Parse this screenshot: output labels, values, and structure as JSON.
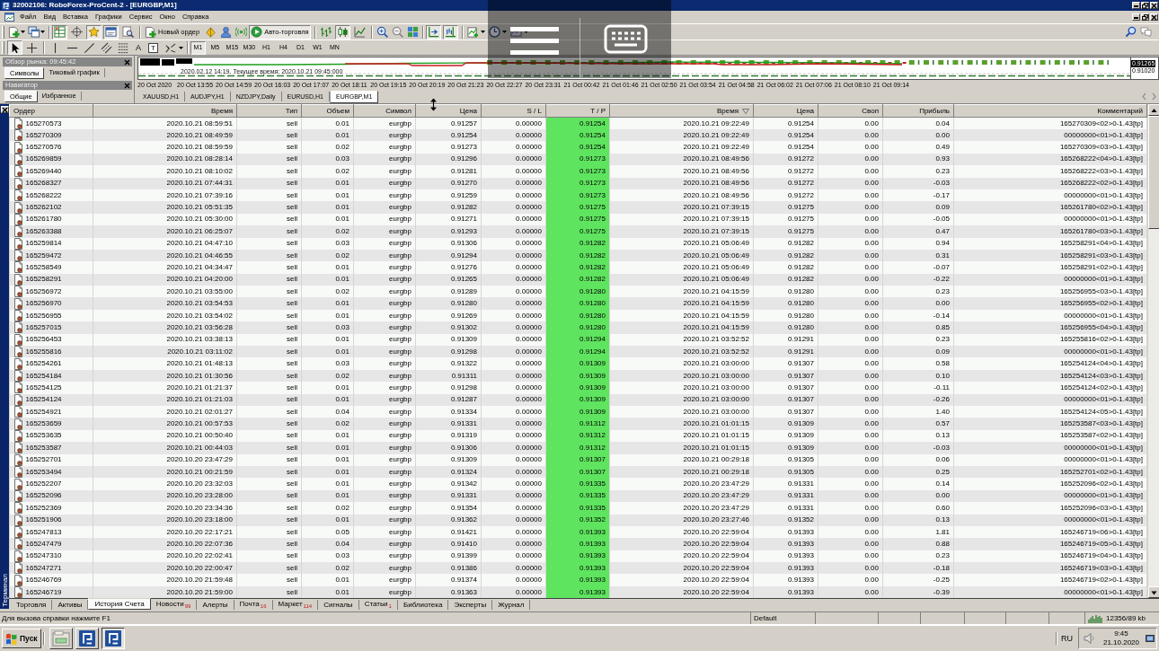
{
  "window": {
    "title": "32002106: RoboForex-ProCent-2 - [EURGBP,M1]"
  },
  "menu": [
    "Файл",
    "Вид",
    "Вставка",
    "Графики",
    "Сервис",
    "Окно",
    "Справка"
  ],
  "toolbar": {
    "panels": [
      {
        "kind": "market_watch",
        "on": true
      },
      {
        "kind": "data_window",
        "on": false
      },
      {
        "kind": "navigator",
        "on": true
      },
      {
        "kind": "terminal",
        "on": true
      },
      {
        "kind": "tester",
        "on": false
      }
    ],
    "new_order": "Новый ордер",
    "auto_trading": {
      "label": "Авто-торговля",
      "on": true
    },
    "chart_types": [
      {
        "kind": "bars",
        "selected": false
      },
      {
        "kind": "candles",
        "selected": true
      },
      {
        "kind": "line",
        "selected": false
      }
    ],
    "view_toggles": [
      {
        "kind": "auto_scroll",
        "on": true
      },
      {
        "kind": "chart_shift",
        "on": true
      }
    ]
  },
  "drawing_toolbar": {
    "modes": [
      {
        "kind": "cursor",
        "selected": true
      },
      {
        "kind": "crosshair",
        "selected": false
      }
    ],
    "text_tool": "A",
    "label_tool": "T",
    "periods": [
      {
        "label": "M1",
        "selected": true
      },
      {
        "label": "M5",
        "selected": false
      },
      {
        "label": "M15",
        "selected": false
      },
      {
        "label": "M30",
        "selected": false
      },
      {
        "label": "H1",
        "selected": false
      },
      {
        "label": "H4",
        "selected": false
      },
      {
        "label": "D1",
        "selected": false
      },
      {
        "label": "W1",
        "selected": false
      },
      {
        "label": "MN",
        "selected": false
      }
    ]
  },
  "market_watch": {
    "title": "Обзор рынка: 09:45:42",
    "tabs": [
      {
        "label": "Символы",
        "selected": true
      },
      {
        "label": "Тиковый график",
        "selected": false
      }
    ]
  },
  "navigator": {
    "title": "Навигатор",
    "tabs": [
      {
        "label": "Общие",
        "selected": true
      },
      {
        "label": "Избранное",
        "selected": false
      }
    ]
  },
  "chart": {
    "caption": "2020.02.12 14:19. Текущее время: 2020.10.21 09:45:000",
    "price_labels": [
      {
        "text": "0.91265",
        "kind": "current"
      },
      {
        "text": "0.91020",
        "kind": "level"
      }
    ],
    "time_labels": [
      "20 Oct 2020",
      "20 Oct 13:55",
      "20 Oct 14:59",
      "20 Oct 16:03",
      "20 Oct 17:07",
      "20 Oct 18:11",
      "20 Oct 19:15",
      "20 Oct 20:19",
      "20 Oct 21:23",
      "20 Oct 22:27",
      "20 Oct 23:31",
      "21 Oct 00:42",
      "21 Oct 01:46",
      "21 Oct 02:50",
      "21 Oct 03:54",
      "21 Oct 04:58",
      "21 Oct 06:02",
      "21 Oct 07:06",
      "21 Oct 08:10",
      "21 Oct 09:14"
    ],
    "tabs": [
      {
        "label": "XAUUSD,H1",
        "selected": false
      },
      {
        "label": "AUDJPY,H1",
        "selected": false
      },
      {
        "label": "NZDJPY,Daily",
        "selected": false
      },
      {
        "label": "EURUSD,H1",
        "selected": false
      },
      {
        "label": "EURGBP,M1",
        "selected": true
      }
    ]
  },
  "terminal": {
    "title": "Терминал",
    "columns": [
      {
        "label": "Ордер",
        "sorted": false,
        "highlighted": false
      },
      {
        "label": "Время",
        "sorted": false,
        "highlighted": false
      },
      {
        "label": "Тип",
        "sorted": false,
        "highlighted": false
      },
      {
        "label": "Объем",
        "sorted": false,
        "highlighted": false
      },
      {
        "label": "Символ",
        "sorted": false,
        "highlighted": false
      },
      {
        "label": "Цена",
        "sorted": false,
        "highlighted": false
      },
      {
        "label": "S / L",
        "sorted": false,
        "highlighted": false
      },
      {
        "label": "T / P",
        "sorted": false,
        "highlighted": true
      },
      {
        "label": "Время",
        "sorted": true,
        "highlighted": false
      },
      {
        "label": "Цена",
        "sorted": false,
        "highlighted": false
      },
      {
        "label": "Своп",
        "sorted": false,
        "highlighted": false
      },
      {
        "label": "Прибыль",
        "sorted": false,
        "highlighted": false
      },
      {
        "label": "Комментарий",
        "sorted": false,
        "highlighted": false
      }
    ],
    "rows": [
      [
        "165270573",
        "2020.10.21 08:59:51",
        "sell",
        "0.01",
        "eurgbp",
        "0.91257",
        "0.00000",
        "0.91254",
        "2020.10.21 09:22:49",
        "0.91254",
        "0.00",
        "0.04",
        "165270309<02>0-1.43[tp]"
      ],
      [
        "165270309",
        "2020.10.21 08:49:59",
        "sell",
        "0.01",
        "eurgbp",
        "0.91254",
        "0.00000",
        "0.91254",
        "2020.10.21 09:22:49",
        "0.91254",
        "0.00",
        "0.00",
        "00000000<01>0-1.43[tp]"
      ],
      [
        "165270576",
        "2020.10.21 08:59:59",
        "sell",
        "0.02",
        "eurgbp",
        "0.91273",
        "0.00000",
        "0.91254",
        "2020.10.21 09:22:49",
        "0.91254",
        "0.00",
        "0.49",
        "165270309<03>0-1.43[tp]"
      ],
      [
        "165269859",
        "2020.10.21 08:28:14",
        "sell",
        "0.03",
        "eurgbp",
        "0.91296",
        "0.00000",
        "0.91273",
        "2020.10.21 08:49:56",
        "0.91272",
        "0.00",
        "0.93",
        "165268222<04>0-1.43[tp]"
      ],
      [
        "165269440",
        "2020.10.21 08:10:02",
        "sell",
        "0.02",
        "eurgbp",
        "0.91281",
        "0.00000",
        "0.91273",
        "2020.10.21 08:49:56",
        "0.91272",
        "0.00",
        "0.23",
        "165268222<03>0-1.43[tp]"
      ],
      [
        "165268327",
        "2020.10.21 07:44:31",
        "sell",
        "0.01",
        "eurgbp",
        "0.91270",
        "0.00000",
        "0.91273",
        "2020.10.21 08:49:56",
        "0.91272",
        "0.00",
        "-0.03",
        "165268222<02>0-1.43[tp]"
      ],
      [
        "165268222",
        "2020.10.21 07:39:16",
        "sell",
        "0.01",
        "eurgbp",
        "0.91259",
        "0.00000",
        "0.91273",
        "2020.10.21 08:49:56",
        "0.91272",
        "0.00",
        "-0.17",
        "00000000<01>0-1.43[tp]"
      ],
      [
        "165262102",
        "2020.10.21 05:51:35",
        "sell",
        "0.01",
        "eurgbp",
        "0.91282",
        "0.00000",
        "0.91275",
        "2020.10.21 07:39:15",
        "0.91275",
        "0.00",
        "0.09",
        "165261780<02>0-1.43[tp]"
      ],
      [
        "165261780",
        "2020.10.21 05:30:00",
        "sell",
        "0.01",
        "eurgbp",
        "0.91271",
        "0.00000",
        "0.91275",
        "2020.10.21 07:39:15",
        "0.91275",
        "0.00",
        "-0.05",
        "00000000<01>0-1.43[tp]"
      ],
      [
        "165263388",
        "2020.10.21 06:25:07",
        "sell",
        "0.02",
        "eurgbp",
        "0.91293",
        "0.00000",
        "0.91275",
        "2020.10.21 07:39:15",
        "0.91275",
        "0.00",
        "0.47",
        "165261780<03>0-1.43[tp]"
      ],
      [
        "165259814",
        "2020.10.21 04:47:10",
        "sell",
        "0.03",
        "eurgbp",
        "0.91306",
        "0.00000",
        "0.91282",
        "2020.10.21 05:06:49",
        "0.91282",
        "0.00",
        "0.94",
        "165258291<04>0-1.43[tp]"
      ],
      [
        "165259472",
        "2020.10.21 04:46:55",
        "sell",
        "0.02",
        "eurgbp",
        "0.91294",
        "0.00000",
        "0.91282",
        "2020.10.21 05:06:49",
        "0.91282",
        "0.00",
        "0.31",
        "165258291<03>0-1.43[tp]"
      ],
      [
        "165258549",
        "2020.10.21 04:34:47",
        "sell",
        "0.01",
        "eurgbp",
        "0.91276",
        "0.00000",
        "0.91282",
        "2020.10.21 05:06:49",
        "0.91282",
        "0.00",
        "-0.07",
        "165258291<02>0-1.43[tp]"
      ],
      [
        "165258291",
        "2020.10.21 04:20:00",
        "sell",
        "0.01",
        "eurgbp",
        "0.91265",
        "0.00000",
        "0.91282",
        "2020.10.21 05:06:49",
        "0.91282",
        "0.00",
        "-0.22",
        "00000000<01>0-1.43[tp]"
      ],
      [
        "165256972",
        "2020.10.21 03:55:00",
        "sell",
        "0.02",
        "eurgbp",
        "0.91289",
        "0.00000",
        "0.91280",
        "2020.10.21 04:15:59",
        "0.91280",
        "0.00",
        "0.23",
        "165256955<03>0-1.43[tp]"
      ],
      [
        "165256970",
        "2020.10.21 03:54:53",
        "sell",
        "0.01",
        "eurgbp",
        "0.91280",
        "0.00000",
        "0.91280",
        "2020.10.21 04:15:59",
        "0.91280",
        "0.00",
        "0.00",
        "165256955<02>0-1.43[tp]"
      ],
      [
        "165256955",
        "2020.10.21 03:54:02",
        "sell",
        "0.01",
        "eurgbp",
        "0.91269",
        "0.00000",
        "0.91280",
        "2020.10.21 04:15:59",
        "0.91280",
        "0.00",
        "-0.14",
        "00000000<01>0-1.43[tp]"
      ],
      [
        "165257015",
        "2020.10.21 03:56:28",
        "sell",
        "0.03",
        "eurgbp",
        "0.91302",
        "0.00000",
        "0.91280",
        "2020.10.21 04:15:59",
        "0.91280",
        "0.00",
        "0.85",
        "165256955<04>0-1.43[tp]"
      ],
      [
        "165256453",
        "2020.10.21 03:38:13",
        "sell",
        "0.01",
        "eurgbp",
        "0.91309",
        "0.00000",
        "0.91294",
        "2020.10.21 03:52:52",
        "0.91291",
        "0.00",
        "0.23",
        "165255816<02>0-1.43[tp]"
      ],
      [
        "165255816",
        "2020.10.21 03:11:02",
        "sell",
        "0.01",
        "eurgbp",
        "0.91298",
        "0.00000",
        "0.91294",
        "2020.10.21 03:52:52",
        "0.91291",
        "0.00",
        "0.09",
        "00000000<01>0-1.43[tp]"
      ],
      [
        "165254261",
        "2020.10.21 01:48:13",
        "sell",
        "0.03",
        "eurgbp",
        "0.91322",
        "0.00000",
        "0.91309",
        "2020.10.21 03:00:00",
        "0.91307",
        "0.00",
        "0.58",
        "165254124<04>0-1.43[tp]"
      ],
      [
        "165254184",
        "2020.10.21 01:30:56",
        "sell",
        "0.02",
        "eurgbp",
        "0.91311",
        "0.00000",
        "0.91309",
        "2020.10.21 03:00:00",
        "0.91307",
        "0.00",
        "0.10",
        "165254124<03>0-1.43[tp]"
      ],
      [
        "165254125",
        "2020.10.21 01:21:37",
        "sell",
        "0.01",
        "eurgbp",
        "0.91298",
        "0.00000",
        "0.91309",
        "2020.10.21 03:00:00",
        "0.91307",
        "0.00",
        "-0.11",
        "165254124<02>0-1.43[tp]"
      ],
      [
        "165254124",
        "2020.10.21 01:21:03",
        "sell",
        "0.01",
        "eurgbp",
        "0.91287",
        "0.00000",
        "0.91309",
        "2020.10.21 03:00:00",
        "0.91307",
        "0.00",
        "-0.26",
        "00000000<01>0-1.43[tp]"
      ],
      [
        "165254921",
        "2020.10.21 02:01:27",
        "sell",
        "0.04",
        "eurgbp",
        "0.91334",
        "0.00000",
        "0.91309",
        "2020.10.21 03:00:00",
        "0.91307",
        "0.00",
        "1.40",
        "165254124<05>0-1.43[tp]"
      ],
      [
        "165253659",
        "2020.10.21 00:57:53",
        "sell",
        "0.02",
        "eurgbp",
        "0.91331",
        "0.00000",
        "0.91312",
        "2020.10.21 01:01:15",
        "0.91309",
        "0.00",
        "0.57",
        "165253587<03>0-1.43[tp]"
      ],
      [
        "165253635",
        "2020.10.21 00:50:40",
        "sell",
        "0.01",
        "eurgbp",
        "0.91319",
        "0.00000",
        "0.91312",
        "2020.10.21 01:01:15",
        "0.91309",
        "0.00",
        "0.13",
        "165253587<02>0-1.43[tp]"
      ],
      [
        "165253587",
        "2020.10.21 00:44:03",
        "sell",
        "0.01",
        "eurgbp",
        "0.91306",
        "0.00000",
        "0.91312",
        "2020.10.21 01:01:15",
        "0.91309",
        "0.00",
        "-0.03",
        "00000000<01>0-1.43[tp]"
      ],
      [
        "165252701",
        "2020.10.20 23:47:29",
        "sell",
        "0.01",
        "eurgbp",
        "0.91309",
        "0.00000",
        "0.91307",
        "2020.10.21 00:29:18",
        "0.91305",
        "0.00",
        "0.06",
        "00000000<01>0-1.43[tp]"
      ],
      [
        "165253494",
        "2020.10.21 00:21:59",
        "sell",
        "0.01",
        "eurgbp",
        "0.91324",
        "0.00000",
        "0.91307",
        "2020.10.21 00:29:18",
        "0.91305",
        "0.00",
        "0.25",
        "165252701<02>0-1.43[tp]"
      ],
      [
        "165252207",
        "2020.10.20 23:32:03",
        "sell",
        "0.01",
        "eurgbp",
        "0.91342",
        "0.00000",
        "0.91335",
        "2020.10.20 23:47:29",
        "0.91331",
        "0.00",
        "0.14",
        "165252096<02>0-1.43[tp]"
      ],
      [
        "165252096",
        "2020.10.20 23:28:00",
        "sell",
        "0.01",
        "eurgbp",
        "0.91331",
        "0.00000",
        "0.91335",
        "2020.10.20 23:47:29",
        "0.91331",
        "0.00",
        "0.00",
        "00000000<01>0-1.43[tp]"
      ],
      [
        "165252369",
        "2020.10.20 23:34:36",
        "sell",
        "0.02",
        "eurgbp",
        "0.91354",
        "0.00000",
        "0.91335",
        "2020.10.20 23:47:29",
        "0.91331",
        "0.00",
        "0.60",
        "165252096<03>0-1.43[tp]"
      ],
      [
        "165251906",
        "2020.10.20 23:18:00",
        "sell",
        "0.01",
        "eurgbp",
        "0.91362",
        "0.00000",
        "0.91352",
        "2020.10.20 23:27:46",
        "0.91352",
        "0.00",
        "0.13",
        "00000000<01>0-1.43[tp]"
      ],
      [
        "165247813",
        "2020.10.20 22:17:21",
        "sell",
        "0.05",
        "eurgbp",
        "0.91421",
        "0.00000",
        "0.91393",
        "2020.10.20 22:59:04",
        "0.91393",
        "0.00",
        "1.81",
        "165246719<06>0-1.43[tp]"
      ],
      [
        "165247479",
        "2020.10.20 22:07:36",
        "sell",
        "0.04",
        "eurgbp",
        "0.91410",
        "0.00000",
        "0.91393",
        "2020.10.20 22:59:04",
        "0.91393",
        "0.00",
        "0.88",
        "165246719<05>0-1.43[tp]"
      ],
      [
        "165247310",
        "2020.10.20 22:02:41",
        "sell",
        "0.03",
        "eurgbp",
        "0.91399",
        "0.00000",
        "0.91393",
        "2020.10.20 22:59:04",
        "0.91393",
        "0.00",
        "0.23",
        "165246719<04>0-1.43[tp]"
      ],
      [
        "165247271",
        "2020.10.20 22:00:47",
        "sell",
        "0.02",
        "eurgbp",
        "0.91386",
        "0.00000",
        "0.91393",
        "2020.10.20 22:59:04",
        "0.91393",
        "0.00",
        "-0.18",
        "165246719<03>0-1.43[tp]"
      ],
      [
        "165246769",
        "2020.10.20 21:59:48",
        "sell",
        "0.01",
        "eurgbp",
        "0.91374",
        "0.00000",
        "0.91393",
        "2020.10.20 22:59:04",
        "0.91393",
        "0.00",
        "-0.25",
        "165246719<02>0-1.43[tp]"
      ],
      [
        "165246719",
        "2020.10.20 21:59:00",
        "sell",
        "0.01",
        "eurgbp",
        "0.91363",
        "0.00000",
        "0.91393",
        "2020.10.20 22:59:04",
        "0.91393",
        "0.00",
        "-0.39",
        "00000000<01>0-1.43[tp]"
      ]
    ],
    "tabs": [
      {
        "label": "Торговля",
        "selected": false
      },
      {
        "label": "Активы",
        "selected": false
      },
      {
        "label": "История Счета",
        "selected": true
      },
      {
        "label": "Новости",
        "count": "99",
        "selected": false
      },
      {
        "label": "Алерты",
        "selected": false
      },
      {
        "label": "Почта",
        "count": "16",
        "selected": false
      },
      {
        "label": "Маркет",
        "count": "114",
        "selected": false
      },
      {
        "label": "Сигналы",
        "selected": false
      },
      {
        "label": "Статьи",
        "count": "1",
        "selected": false
      },
      {
        "label": "Библиотека",
        "selected": false
      },
      {
        "label": "Эксперты",
        "selected": false
      },
      {
        "label": "Журнал",
        "selected": false
      }
    ]
  },
  "status_bar": {
    "help": "Для вызова справки нажмите F1",
    "profile": "Default",
    "traffic": "12356/89 kb"
  },
  "taskbar": {
    "start": "Пуск",
    "language": "RU",
    "time": "9:45",
    "date": "21.10.2020"
  }
}
